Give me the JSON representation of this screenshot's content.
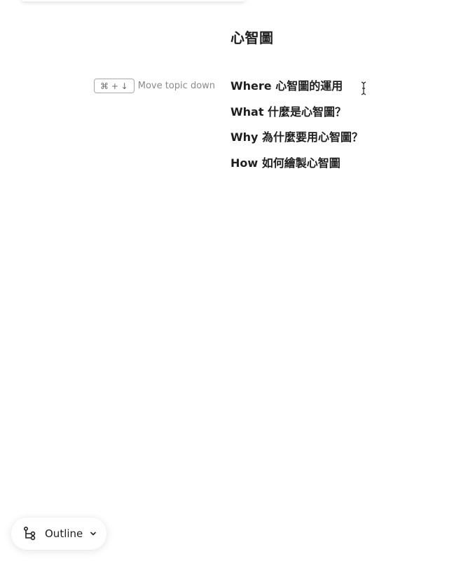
{
  "document": {
    "title": "心智圖"
  },
  "shortcut_hint": {
    "keys": "⌘ + ↓",
    "label": "Move topic down"
  },
  "topics": [
    {
      "label": "Where 心智圖的運用"
    },
    {
      "label": "What 什麼是心智圖？"
    },
    {
      "label": "Why 為什麼要用心智圖？"
    },
    {
      "label": "How 如何繪製心智圖"
    }
  ],
  "view_switcher": {
    "label": "Outline",
    "icon": "outline-tree-icon",
    "dropdown_icon": "chevron-down-icon"
  }
}
